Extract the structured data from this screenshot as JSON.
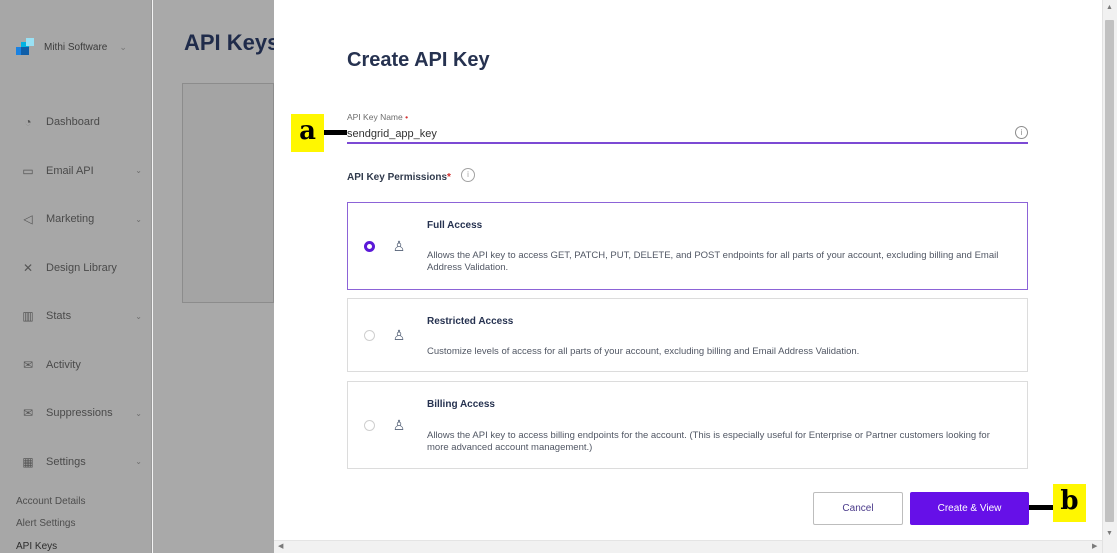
{
  "sidebar": {
    "account_name": "Mithi Software",
    "items": [
      {
        "label": "Dashboard",
        "icon": "dashboard-icon",
        "has_chevron": false
      },
      {
        "label": "Email API",
        "icon": "email-api-icon",
        "has_chevron": true
      },
      {
        "label": "Marketing",
        "icon": "megaphone-icon",
        "has_chevron": true
      },
      {
        "label": "Design Library",
        "icon": "design-library-icon",
        "has_chevron": false
      },
      {
        "label": "Stats",
        "icon": "stats-icon",
        "has_chevron": true
      },
      {
        "label": "Activity",
        "icon": "activity-icon",
        "has_chevron": false
      },
      {
        "label": "Suppressions",
        "icon": "suppressions-icon",
        "has_chevron": true
      },
      {
        "label": "Settings",
        "icon": "settings-icon",
        "has_chevron": true
      }
    ],
    "sub_items": [
      "Account Details",
      "Alert Settings",
      "API Keys"
    ]
  },
  "main": {
    "title": "API Keys"
  },
  "modal": {
    "title": "Create API Key",
    "name_label": "API Key Name",
    "name_value": "sendgrid_app_key",
    "permissions_label": "API Key Permissions",
    "required_mark": "*",
    "options": [
      {
        "title": "Full Access",
        "description": "Allows the API key to access GET, PATCH, PUT, DELETE, and POST endpoints for all parts of your account, excluding billing and Email Address Validation.",
        "selected": true
      },
      {
        "title": "Restricted Access",
        "description": "Customize levels of access for all parts of your account, excluding billing and Email Address Validation.",
        "selected": false
      },
      {
        "title": "Billing Access",
        "description": "Allows the API key to access billing endpoints for the account. (This is especially useful for Enterprise or Partner customers looking for more advanced account management.)",
        "selected": false
      }
    ],
    "cancel_label": "Cancel",
    "create_label": "Create & View"
  },
  "annotations": {
    "a": "a",
    "b": "b"
  },
  "colors": {
    "accent": "#6610e8",
    "sidebar_bg": "#a7a7a7",
    "title": "#263250"
  }
}
